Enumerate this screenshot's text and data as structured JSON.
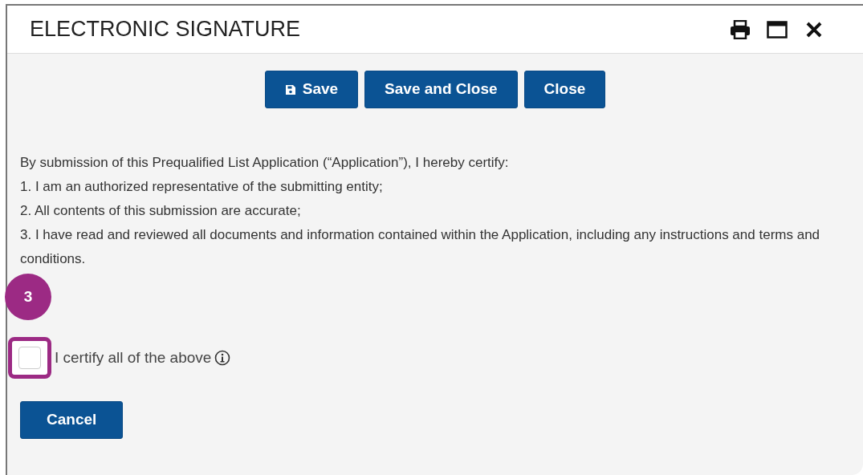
{
  "window": {
    "title": "ELECTRONIC SIGNATURE"
  },
  "title_actions": [
    {
      "kind": "print"
    },
    {
      "kind": "maximize"
    },
    {
      "kind": "close"
    }
  ],
  "toolbar": [
    {
      "label": "Save",
      "kind": "save"
    },
    {
      "label": "Save and Close",
      "kind": "plain"
    },
    {
      "label": "Close",
      "kind": "plain"
    }
  ],
  "statement": [
    "By submission of this Prequalified List Application (“Application”), I hereby certify:",
    "1. I am an authorized representative of the submitting entity;",
    "2. All contents of this submission are accurate;",
    "3. I have read and reviewed all documents and information contained within the Application, including any instructions and terms and conditions."
  ],
  "callout": {
    "number": "3"
  },
  "certify": {
    "label": "I certify all of the above",
    "checked": false,
    "highlighted": true
  },
  "footer_buttons": [
    {
      "label": "Cancel"
    }
  ]
}
